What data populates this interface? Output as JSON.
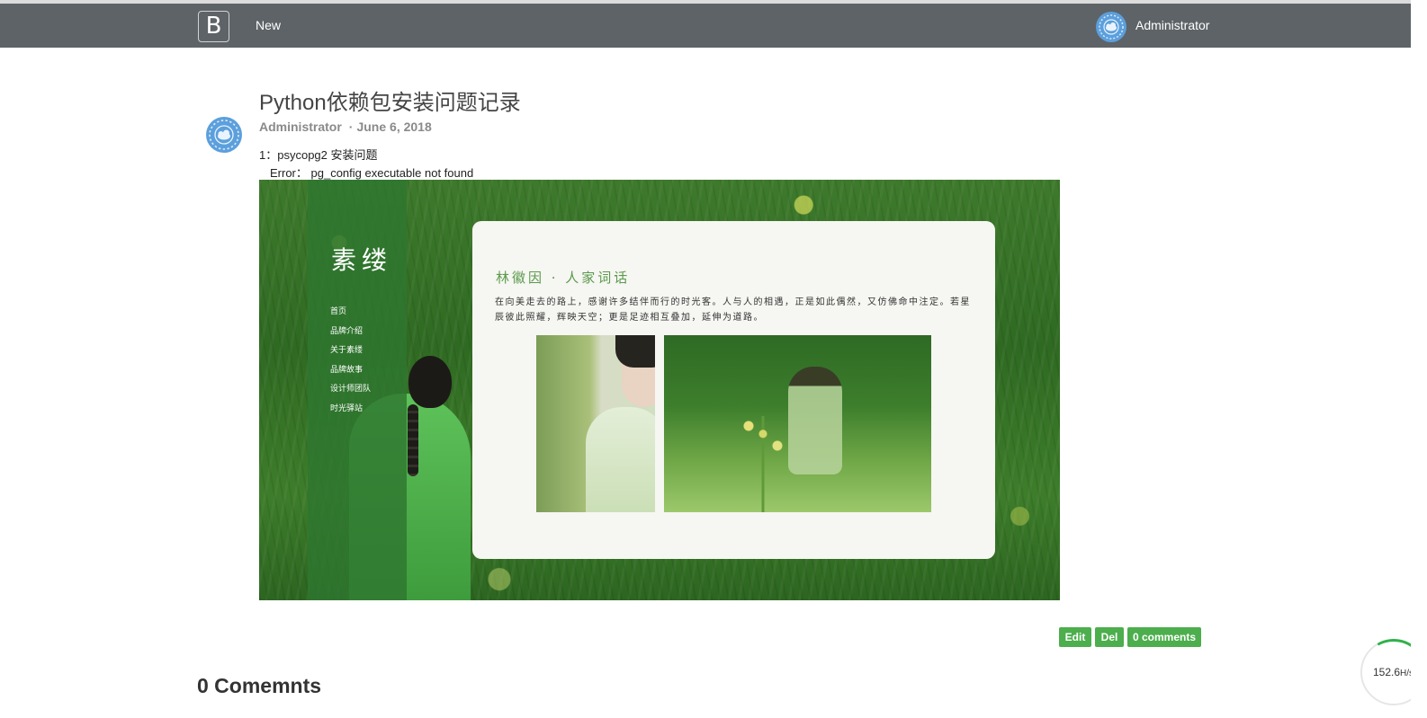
{
  "navbar": {
    "brand": "B",
    "new_link": "New",
    "user_name": "Administrator"
  },
  "post": {
    "title": "Python依赖包安装问题记录",
    "author": "Administrator",
    "separator": "·",
    "date": "June 6, 2018",
    "lines": [
      "1：psycopg2 安装问题",
      "Error： pg_config executable not found"
    ],
    "image": {
      "sidebar_title": "素缕",
      "menu": [
        "首页",
        "品牌介绍",
        "关于素缕",
        "品牌故事",
        "设计师团队",
        "时光驿站"
      ],
      "card_title": "林徽因 · 人家词话",
      "card_text": "在向美走去的路上，感谢许多结伴而行的时光客。人与人的相遇，正是如此偶然，又仿佛命中注定。若星辰彼此照耀，辉映天空；更是足迹相互叠加，延伸为道路。"
    },
    "actions": {
      "edit": "Edit",
      "delete": "Del",
      "comments": "0 comments"
    }
  },
  "comments_heading": "0 Comemnts",
  "speed_widget": {
    "value": "152.6",
    "unit": "H/s"
  },
  "colors": {
    "navbar": "#5e6367",
    "button_green": "#4cae4c",
    "speed_arc": "#2fb24a"
  }
}
